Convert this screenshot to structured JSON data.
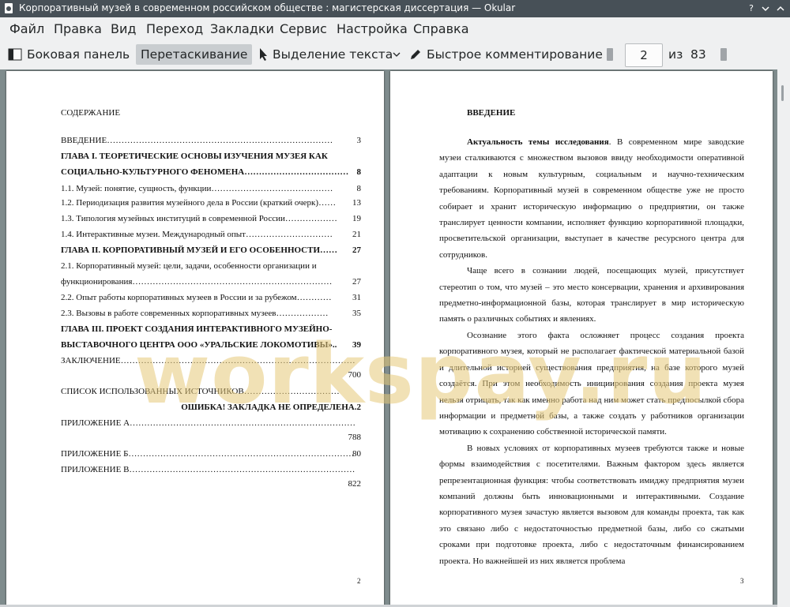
{
  "window": {
    "title": "Корпоративный музей в современном российском обществе : магистерская диссертация  — Okular"
  },
  "menu": [
    "Файл",
    "Правка",
    "Вид",
    "Переход",
    "Закладки",
    "Сервис",
    "Настройка",
    "Справка"
  ],
  "toolbar": {
    "sidebar_label": "Боковая панель",
    "drag_label": "Перетаскивание",
    "text_select_label": "Выделение текста",
    "quick_comment_label": "Быстрое комментирование",
    "current_page": "2",
    "of_label": "из",
    "total_pages": "83"
  },
  "page2": {
    "heading": "СОДЕРЖАНИЕ",
    "toc": [
      {
        "label": "ВВЕДЕНИЕ……………………………………………………………………",
        "num": "3",
        "bold": false
      },
      {
        "label": "ГЛАВА I. ТЕОРЕТИЧЕСКИЕ ОСНОВЫ ИЗУЧЕНИЯ МУЗЕЯ КАК",
        "num": "",
        "bold": true
      },
      {
        "label": "СОЦИАЛЬНО-КУЛЬТУРНОГО ФЕНОМЕНА………………………………",
        "num": "8",
        "bold": true
      },
      {
        "label": "1.1.    Музей: понятие, сущность, функции……………………………………",
        "num": "8",
        "bold": false
      },
      {
        "label": "1.2.    Периодизация развития музейного дела в России (краткий очерк)……",
        "num": "13",
        "bold": false
      },
      {
        "label": "1.3.    Типология музейных институций в современной России………………",
        "num": "19",
        "bold": false
      },
      {
        "label": "1.4.    Интерактивные музеи. Международный опыт…………………………",
        "num": "21",
        "bold": false
      },
      {
        "label": "ГЛАВА II. КОРПОРАТИВНЫЙ МУЗЕЙ И ЕГО ОСОБЕННОСТИ……",
        "num": "27",
        "bold": true
      },
      {
        "label": "2.1. Корпоративный музей: цели, задачи, особенности организации и",
        "num": "",
        "bold": false
      },
      {
        "label": "функционирования……………………………………………………………",
        "num": "27",
        "bold": false
      },
      {
        "label": "2.2. Опыт работы корпоративных музеев в России и за рубежом…………",
        "num": "31",
        "bold": false
      },
      {
        "label": "2.3. Вызовы в работе современных корпоративных музеев………………",
        "num": "35",
        "bold": false
      },
      {
        "label": "ГЛАВА III. ПРОЕКТ СОЗДАНИЯ ИНТЕРАКТИВНОГО МУЗЕЙНО-",
        "num": "",
        "bold": true
      },
      {
        "label": "ВЫСТАВОЧНОГО ЦЕНТРА ООО «УРАЛЬСКИЕ ЛОКОМОТИВЫ»..",
        "num": "39",
        "bold": true
      },
      {
        "label": "ЗАКЛЮЧЕНИЕ………………………………………………………………………",
        "num": "",
        "bold": false
      },
      {
        "label": "",
        "num": "700",
        "bold": false
      },
      {
        "label": "СПИСОК ИСПОЛЬЗОВАННЫХ ИСТОЧНИКОВ……………………………",
        "num": "",
        "bold": false
      },
      {
        "label": "",
        "num": "ОШИБКА! ЗАКЛАДКА НЕ ОПРЕДЕЛЕНА.2",
        "bold": true
      },
      {
        "label": "ПРИЛОЖЕНИЕ А……………………………………………………………………",
        "num": "",
        "bold": false
      },
      {
        "label": "",
        "num": "788",
        "bold": false
      },
      {
        "label": "ПРИЛОЖЕНИЕ Б……………………………………………………………………",
        "num": "80",
        "bold": false
      },
      {
        "label": "ПРИЛОЖЕНИЕ В……………………………………………………………………",
        "num": "",
        "bold": false
      },
      {
        "label": "",
        "num": "822",
        "bold": false
      }
    ],
    "page_number": "2"
  },
  "page3": {
    "heading": "ВВЕДЕНИЕ",
    "p1_bold": "Актуальность темы исследования",
    "p1": ". В современном мире заводские музеи сталкиваются с множеством вызовов ввиду необходимости оперативной адаптации к новым культурным, социальным и научно-техническим требованиям. Корпоративный музей в современном обществе уже не просто собирает и хранит историческую информацию о предприятии, он также транслирует ценности компании, исполняет функцию корпоративной площадки, просветительской организации, выступает в качестве ресурсного центра для сотрудников.",
    "p2": "Чаще всего в сознании людей, посещающих музей, присутствует стереотип о том, что музей – это место консервации, хранения и архивирования предметно-информационной базы, которая транслирует в мир историческую память о различных событиях и явлениях.",
    "p3": "Осознание этого факта осложняет процесс создания проекта корпоративного музея, который не располагает фактической материальной базой и длительной историей существования предприятия, на базе которого музей создаётся. При этом необходимость инициирования создания проекта музея нельзя отрицать, так как именно работа над ним может стать предпосылкой сбора информации и предметной базы, а также создать у работников организации мотивацию к сохранению собственной исторической памяти.",
    "p4": "В новых условиях от корпоративных музеев требуются также и новые формы взаимодействия с посетителями. Важным фактором здесь является репрезентационная функция: чтобы соответствовать имиджу предприятия музеи компаний должны быть инновационными и интерактивными. Создание корпоративного музея зачастую является вызовом для команды проекта, так как это связано либо с недостаточностью предметной базы, либо со сжатыми сроками при подготовке проекта, либо с недостаточным финансированием проекта. Но важнейшей из них является проблема",
    "page_number": "3"
  },
  "watermark": "workspay.ru"
}
